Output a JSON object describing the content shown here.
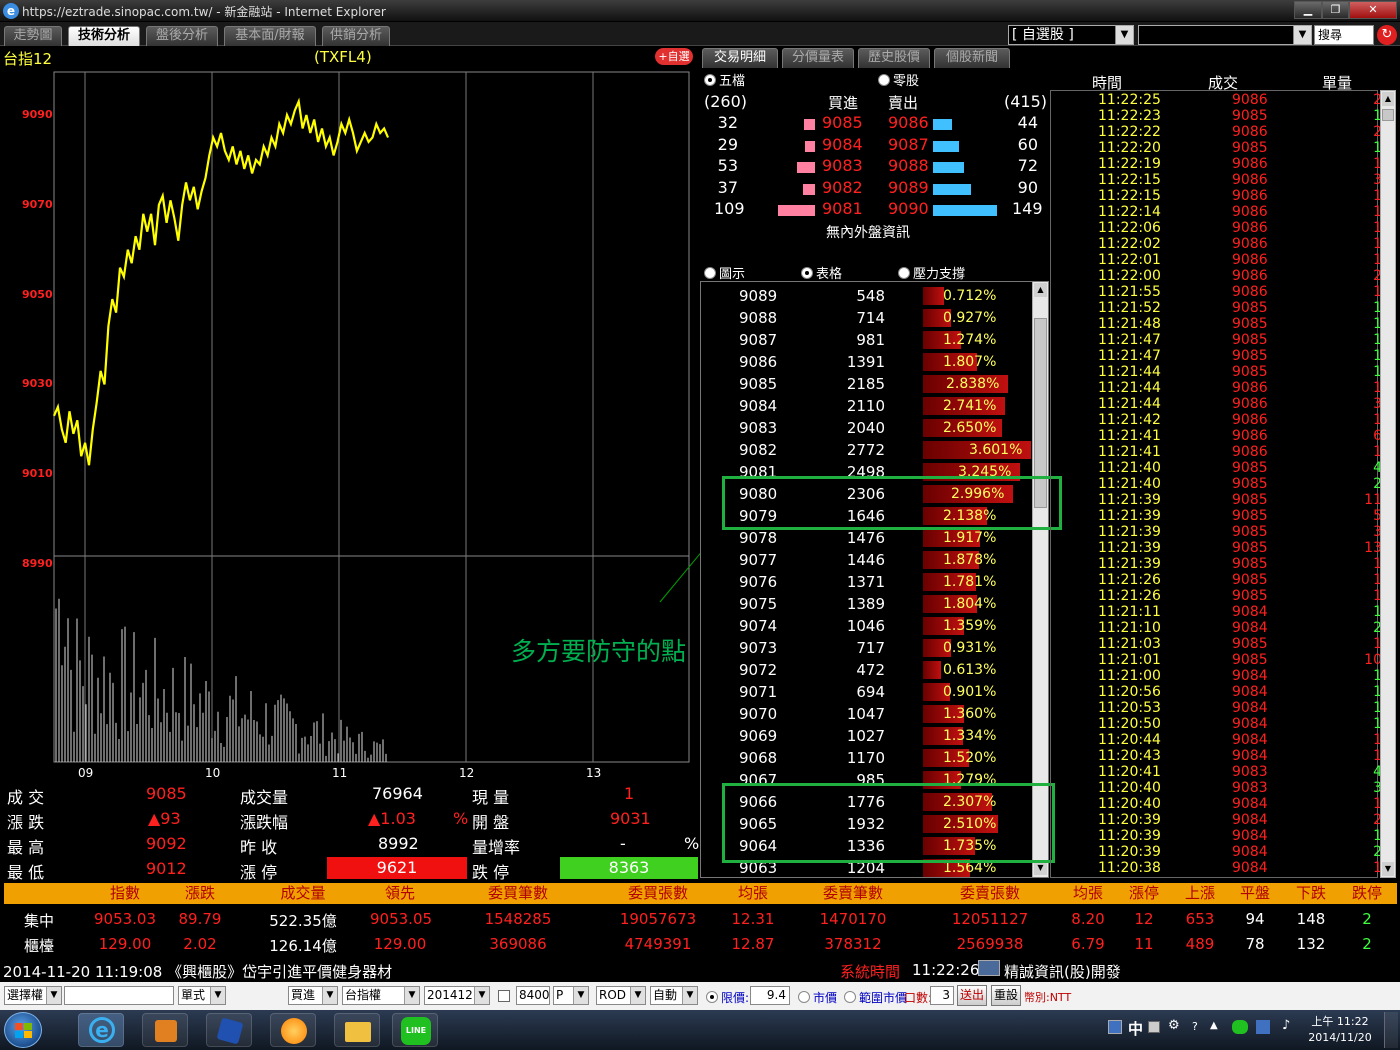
{
  "window": {
    "title": "https://eztrade.sinopac.com.tw/ - 新金融站 - Internet Explorer",
    "ie_icon": "e"
  },
  "tabs": [
    {
      "label": "走勢圖"
    },
    {
      "label": "技術分析"
    },
    {
      "label": "盤後分析"
    },
    {
      "label": "基本面/財報"
    },
    {
      "label": "供銷分析"
    }
  ],
  "watchlist_combo": "[ 自選股 ]",
  "search_label": "搜尋",
  "chart": {
    "symbol_title": "台指12",
    "contract": "(TXFL4)",
    "add_watch_label": "+自選",
    "annotation": "多方要防守的點",
    "chart_data": {
      "type": "line",
      "title": "",
      "xlabel": "",
      "ylabel": "",
      "ylim": [
        8990,
        9100
      ],
      "y_ticks": [
        "9090",
        "9070",
        "9050",
        "9030",
        "9010",
        "8990"
      ],
      "x_ticks": [
        "09",
        "10",
        "11",
        "12",
        "13"
      ],
      "series": [
        {
          "values": [
            9023,
            9025,
            9020,
            9017,
            9024,
            9019,
            9022,
            9014,
            9017,
            9012,
            9020,
            9026,
            9033,
            9030,
            9043,
            9049,
            9046,
            9056,
            9054,
            9060,
            9057,
            9063,
            9060,
            9068,
            9064,
            9068,
            9061,
            9070,
            9072,
            9066,
            9071,
            9067,
            9062,
            9070,
            9075,
            9071,
            9074,
            9069,
            9073,
            9076,
            9081,
            9085,
            9083,
            9086,
            9082,
            9080,
            9083,
            9079,
            9082,
            9078,
            9081,
            9077,
            9080,
            9079,
            9083,
            9081,
            9085,
            9083,
            9088,
            9086,
            9090,
            9088,
            9091,
            9093,
            9087,
            9090,
            9086,
            9089,
            9084,
            9087,
            9083,
            9085,
            9081,
            9084,
            9088,
            9086,
            9089,
            9086,
            9082,
            9084,
            9086,
            9084,
            9085,
            9088,
            9086,
            9087,
            9085
          ]
        }
      ]
    }
  },
  "quote": {
    "trade_label": "成 交",
    "trade": "9085",
    "volume_label": "成交量",
    "volume": "76964",
    "current_qty_label": "現 量",
    "current_qty": "1",
    "change_label": "漲 跌",
    "change": "▲93",
    "change_pct_label": "漲跌幅",
    "change_pct": "▲1.03",
    "pct_sign": "%",
    "open_label": "開 盤",
    "open": "9031",
    "high_label": "最 高",
    "high": "9092",
    "prev_close_label": "昨 收",
    "prev_close": "8992",
    "vol_ratio_label": "量增率",
    "vol_ratio": "-",
    "vol_ratio_unit": "%",
    "low_label": "最 低",
    "low": "9012",
    "limit_up_label": "漲 停",
    "limit_up": "9621",
    "limit_down_label": "跌 停",
    "limit_down": "8363"
  },
  "subtabs": [
    {
      "label": "交易明細"
    },
    {
      "label": "分價量表"
    },
    {
      "label": "歷史股價"
    },
    {
      "label": "個股新聞"
    }
  ],
  "orderbook": {
    "opt_five": "五檔",
    "opt_odd": "零股",
    "bid_total": "(260)",
    "bid_header": "買進",
    "ask_header": "賣出",
    "ask_total": "(415)",
    "no_info": "無內外盤資訊",
    "rows": [
      {
        "bid_qty": "32",
        "bid": "9085",
        "ask": "9086",
        "ask_qty": "44",
        "bid_frac": 0.21,
        "ask_frac": 0.3
      },
      {
        "bid_qty": "29",
        "bid": "9084",
        "ask": "9087",
        "ask_qty": "60",
        "bid_frac": 0.19,
        "ask_frac": 0.4
      },
      {
        "bid_qty": "53",
        "bid": "9083",
        "ask": "9088",
        "ask_qty": "72",
        "bid_frac": 0.35,
        "ask_frac": 0.48
      },
      {
        "bid_qty": "37",
        "bid": "9082",
        "ask": "9089",
        "ask_qty": "90",
        "bid_frac": 0.24,
        "ask_frac": 0.6
      },
      {
        "bid_qty": "109",
        "bid": "9081",
        "ask": "9090",
        "ask_qty": "149",
        "bid_frac": 0.73,
        "ask_frac": 1.0
      }
    ]
  },
  "ladder": {
    "opt_chart": "圖示",
    "opt_table": "表格",
    "opt_pressure": "壓力支撐",
    "rows": [
      {
        "price": "9089",
        "vol": "548",
        "pct": "0.712%",
        "frac": 0.198
      },
      {
        "price": "9088",
        "vol": "714",
        "pct": "0.927%",
        "frac": 0.257
      },
      {
        "price": "9087",
        "vol": "981",
        "pct": "1.274%",
        "frac": 0.354
      },
      {
        "price": "9086",
        "vol": "1391",
        "pct": "1.807%",
        "frac": 0.502
      },
      {
        "price": "9085",
        "vol": "2185",
        "pct": "2.838%",
        "frac": 0.788
      },
      {
        "price": "9084",
        "vol": "2110",
        "pct": "2.741%",
        "frac": 0.761
      },
      {
        "price": "9083",
        "vol": "2040",
        "pct": "2.650%",
        "frac": 0.736
      },
      {
        "price": "9082",
        "vol": "2772",
        "pct": "3.601%",
        "frac": 1.0
      },
      {
        "price": "9081",
        "vol": "2498",
        "pct": "3.245%",
        "frac": 0.901
      },
      {
        "price": "9080",
        "vol": "2306",
        "pct": "2.996%",
        "frac": 0.832
      },
      {
        "price": "9079",
        "vol": "1646",
        "pct": "2.138%",
        "frac": 0.594
      },
      {
        "price": "9078",
        "vol": "1476",
        "pct": "1.917%",
        "frac": 0.532
      },
      {
        "price": "9077",
        "vol": "1446",
        "pct": "1.878%",
        "frac": 0.522
      },
      {
        "price": "9076",
        "vol": "1371",
        "pct": "1.781%",
        "frac": 0.495
      },
      {
        "price": "9075",
        "vol": "1389",
        "pct": "1.804%",
        "frac": 0.501
      },
      {
        "price": "9074",
        "vol": "1046",
        "pct": "1.359%",
        "frac": 0.377
      },
      {
        "price": "9073",
        "vol": "717",
        "pct": "0.931%",
        "frac": 0.259
      },
      {
        "price": "9072",
        "vol": "472",
        "pct": "0.613%",
        "frac": 0.17
      },
      {
        "price": "9071",
        "vol": "694",
        "pct": "0.901%",
        "frac": 0.25
      },
      {
        "price": "9070",
        "vol": "1047",
        "pct": "1.360%",
        "frac": 0.378
      },
      {
        "price": "9069",
        "vol": "1027",
        "pct": "1.334%",
        "frac": 0.37
      },
      {
        "price": "9068",
        "vol": "1170",
        "pct": "1.520%",
        "frac": 0.422
      },
      {
        "price": "9067",
        "vol": "985",
        "pct": "1.279%",
        "frac": 0.355
      },
      {
        "price": "9066",
        "vol": "1776",
        "pct": "2.307%",
        "frac": 0.641
      },
      {
        "price": "9065",
        "vol": "1932",
        "pct": "2.510%",
        "frac": 0.697
      },
      {
        "price": "9064",
        "vol": "1336",
        "pct": "1.735%",
        "frac": 0.482
      },
      {
        "price": "9063",
        "vol": "1204",
        "pct": "1.564%",
        "frac": 0.434
      }
    ]
  },
  "trades": {
    "time_header": "時間",
    "price_header": "成交",
    "qty_header": "單量",
    "rows": [
      {
        "time": "11:22:25",
        "price": "9086",
        "qty": "2",
        "color": "#ff2020"
      },
      {
        "time": "11:22:23",
        "price": "9085",
        "qty": "1",
        "color": "#40ff40"
      },
      {
        "time": "11:22:22",
        "price": "9086",
        "qty": "2",
        "color": "#ff2020"
      },
      {
        "time": "11:22:20",
        "price": "9085",
        "qty": "1",
        "color": "#40ff40"
      },
      {
        "time": "11:22:19",
        "price": "9086",
        "qty": "1",
        "color": "#ff2020"
      },
      {
        "time": "11:22:15",
        "price": "9086",
        "qty": "3",
        "color": "#ff2020"
      },
      {
        "time": "11:22:15",
        "price": "9086",
        "qty": "1",
        "color": "#ff2020"
      },
      {
        "time": "11:22:14",
        "price": "9086",
        "qty": "1",
        "color": "#ff2020"
      },
      {
        "time": "11:22:06",
        "price": "9086",
        "qty": "1",
        "color": "#ff2020"
      },
      {
        "time": "11:22:02",
        "price": "9086",
        "qty": "1",
        "color": "#ff2020"
      },
      {
        "time": "11:22:01",
        "price": "9086",
        "qty": "1",
        "color": "#ff2020"
      },
      {
        "time": "11:22:00",
        "price": "9086",
        "qty": "2",
        "color": "#ff2020"
      },
      {
        "time": "11:21:55",
        "price": "9086",
        "qty": "1",
        "color": "#ff2020"
      },
      {
        "time": "11:21:52",
        "price": "9085",
        "qty": "1",
        "color": "#40ff40"
      },
      {
        "time": "11:21:48",
        "price": "9085",
        "qty": "1",
        "color": "#40ff40"
      },
      {
        "time": "11:21:47",
        "price": "9085",
        "qty": "1",
        "color": "#40ff40"
      },
      {
        "time": "11:21:47",
        "price": "9085",
        "qty": "1",
        "color": "#40ff40"
      },
      {
        "time": "11:21:44",
        "price": "9085",
        "qty": "1",
        "color": "#40ff40"
      },
      {
        "time": "11:21:44",
        "price": "9086",
        "qty": "1",
        "color": "#ff2020"
      },
      {
        "time": "11:21:44",
        "price": "9086",
        "qty": "3",
        "color": "#ff2020"
      },
      {
        "time": "11:21:42",
        "price": "9086",
        "qty": "1",
        "color": "#ff2020"
      },
      {
        "time": "11:21:41",
        "price": "9086",
        "qty": "6",
        "color": "#ff2020"
      },
      {
        "time": "11:21:41",
        "price": "9086",
        "qty": "1",
        "color": "#ff2020"
      },
      {
        "time": "11:21:40",
        "price": "9085",
        "qty": "4",
        "color": "#40ff40"
      },
      {
        "time": "11:21:40",
        "price": "9085",
        "qty": "2",
        "color": "#40ff40"
      },
      {
        "time": "11:21:39",
        "price": "9085",
        "qty": "11",
        "color": "#ff2020"
      },
      {
        "time": "11:21:39",
        "price": "9085",
        "qty": "5",
        "color": "#ff2020"
      },
      {
        "time": "11:21:39",
        "price": "9085",
        "qty": "3",
        "color": "#ff2020"
      },
      {
        "time": "11:21:39",
        "price": "9085",
        "qty": "13",
        "color": "#ff2020"
      },
      {
        "time": "11:21:39",
        "price": "9085",
        "qty": "1",
        "color": "#ff2020"
      },
      {
        "time": "11:21:26",
        "price": "9085",
        "qty": "1",
        "color": "#ff2020"
      },
      {
        "time": "11:21:26",
        "price": "9085",
        "qty": "1",
        "color": "#ff2020"
      },
      {
        "time": "11:21:11",
        "price": "9084",
        "qty": "1",
        "color": "#40ff40"
      },
      {
        "time": "11:21:10",
        "price": "9084",
        "qty": "2",
        "color": "#40ff40"
      },
      {
        "time": "11:21:03",
        "price": "9085",
        "qty": "1",
        "color": "#ff2020"
      },
      {
        "time": "11:21:01",
        "price": "9085",
        "qty": "10",
        "color": "#ff2020"
      },
      {
        "time": "11:21:00",
        "price": "9084",
        "qty": "1",
        "color": "#40ff40"
      },
      {
        "time": "11:20:56",
        "price": "9084",
        "qty": "1",
        "color": "#40ff40"
      },
      {
        "time": "11:20:53",
        "price": "9084",
        "qty": "1",
        "color": "#40ff40"
      },
      {
        "time": "11:20:50",
        "price": "9084",
        "qty": "1",
        "color": "#40ff40"
      },
      {
        "time": "11:20:44",
        "price": "9084",
        "qty": "1",
        "color": "#ff2020"
      },
      {
        "time": "11:20:43",
        "price": "9084",
        "qty": "1",
        "color": "#ff2020"
      },
      {
        "time": "11:20:41",
        "price": "9083",
        "qty": "4",
        "color": "#40ff40"
      },
      {
        "time": "11:20:40",
        "price": "9083",
        "qty": "3",
        "color": "#40ff40"
      },
      {
        "time": "11:20:40",
        "price": "9084",
        "qty": "1",
        "color": "#ff2020"
      },
      {
        "time": "11:20:39",
        "price": "9084",
        "qty": "2",
        "color": "#ff2020"
      },
      {
        "time": "11:20:39",
        "price": "9084",
        "qty": "1",
        "color": "#40ff40"
      },
      {
        "time": "11:20:39",
        "price": "9084",
        "qty": "2",
        "color": "#40ff40"
      },
      {
        "time": "11:20:38",
        "price": "9084",
        "qty": "1",
        "color": "#ff2020"
      }
    ]
  },
  "summary": {
    "headers": [
      "指數",
      "漲跌",
      "成交量",
      "領先",
      "委買筆數",
      "委買張數",
      "均張",
      "委賣筆數",
      "委賣張數",
      "均張",
      "漲停",
      "上漲",
      "平盤",
      "下跌",
      "跌停"
    ],
    "rows": [
      {
        "name": "集中",
        "values": [
          "9053.03",
          "89.79",
          "522.35億",
          "9053.05",
          "1548285",
          "19057673",
          "12.31",
          "1470170",
          "12051127",
          "8.20",
          "12",
          "653",
          "94",
          "148",
          "2"
        ]
      },
      {
        "name": "櫃檯",
        "values": [
          "129.00",
          "2.02",
          "126.14億",
          "129.00",
          "369086",
          "4749391",
          "12.87",
          "378312",
          "2569938",
          "6.79",
          "11",
          "489",
          "78",
          "132",
          "2"
        ]
      }
    ]
  },
  "statusbar": {
    "news": "2014-11-20 11:19:08 《興櫃股》岱宇引進平價健身器材",
    "sys_time_label": "系統時間",
    "sys_time": "11:22:26",
    "broker_msg": "精誠資訊(股)開發"
  },
  "orderbar": {
    "select_account": "選擇權",
    "mode": "單式",
    "side": "買進",
    "product": "台指權",
    "month": "201412",
    "strike": "8400",
    "cp": "P",
    "rod": "ROD",
    "auto": "自動",
    "limit_label": "限價:",
    "limit_value": "9.4",
    "market_label": "市價",
    "range_label": "範圍市價",
    "qty_label": "口數:",
    "qty": "3",
    "send": "送出",
    "reset": "重設",
    "unit_label": "幣別:NTT"
  },
  "taskbar": {
    "clock_time": "上午 11:22",
    "clock_date": "2014/11/20",
    "ime": "中",
    "line_label": "LINE"
  }
}
